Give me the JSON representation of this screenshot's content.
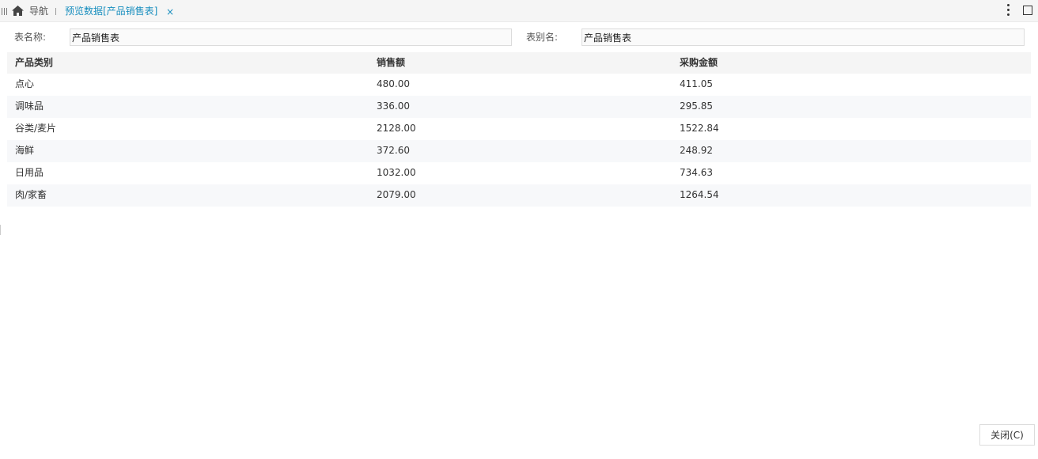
{
  "tabbar": {
    "nav_label": "导航",
    "active_tab_title": "预览数据[产品销售表]",
    "close_glyph": "×"
  },
  "form": {
    "table_name_label": "表名称:",
    "table_name_value": "产品销售表",
    "table_alias_label": "表别名:",
    "table_alias_value": "产品销售表"
  },
  "table": {
    "columns": [
      "产品类别",
      "销售额",
      "采购金额"
    ],
    "rows": [
      [
        "点心",
        "480.00",
        "411.05"
      ],
      [
        "调味品",
        "336.00",
        "295.85"
      ],
      [
        "谷类/麦片",
        "2128.00",
        "1522.84"
      ],
      [
        "海鲜",
        "372.60",
        "248.92"
      ],
      [
        "日用品",
        "1032.00",
        "734.63"
      ],
      [
        "肉/家畜",
        "2079.00",
        "1264.54"
      ]
    ]
  },
  "footer": {
    "close_label": "关闭(C)"
  },
  "colors": {
    "accent": "#1a8fbf",
    "header_bg": "#f5f5f5",
    "row_alt_bg": "#f7f8fa"
  }
}
